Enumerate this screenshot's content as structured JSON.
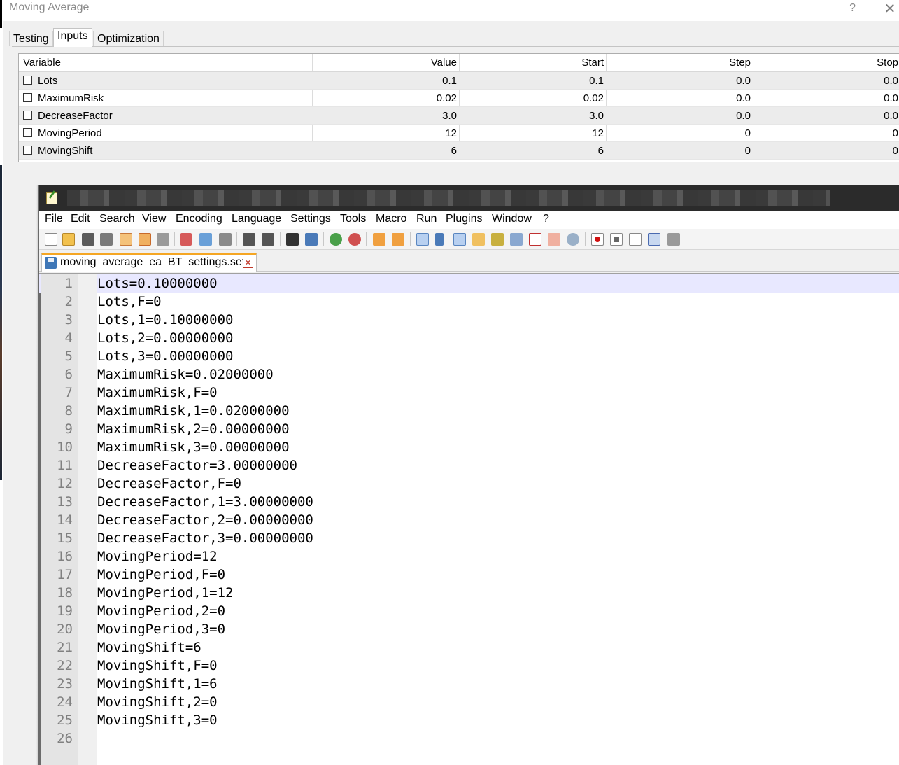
{
  "dialog": {
    "title": "Moving Average",
    "help_label": "?",
    "close_label": "✕",
    "tabs": [
      {
        "label": "Testing",
        "active": false
      },
      {
        "label": "Inputs",
        "active": true
      },
      {
        "label": "Optimization",
        "active": false
      }
    ],
    "grid": {
      "headers": [
        "Variable",
        "Value",
        "Start",
        "Step",
        "Stop"
      ],
      "rows": [
        {
          "variable": "Lots",
          "value": "0.1",
          "start": "0.1",
          "step": "0.0",
          "stop": "0.0",
          "checked": false
        },
        {
          "variable": "MaximumRisk",
          "value": "0.02",
          "start": "0.02",
          "step": "0.0",
          "stop": "0.0",
          "checked": false
        },
        {
          "variable": "DecreaseFactor",
          "value": "3.0",
          "start": "3.0",
          "step": "0.0",
          "stop": "0.0",
          "checked": false
        },
        {
          "variable": "MovingPeriod",
          "value": "12",
          "start": "12",
          "step": "0",
          "stop": "0",
          "checked": false
        },
        {
          "variable": "MovingShift",
          "value": "6",
          "start": "6",
          "step": "0",
          "stop": "0",
          "checked": false
        }
      ]
    }
  },
  "notepad": {
    "menu": [
      "File",
      "Edit",
      "Search",
      "View",
      "Encoding",
      "Language",
      "Settings",
      "Tools",
      "Macro",
      "Run",
      "Plugins",
      "Window",
      "?"
    ],
    "toolbar_icons": [
      "new-file-icon",
      "open-file-icon",
      "save-icon",
      "save-all-icon",
      "close-icon",
      "close-all-icon",
      "print-icon",
      "cut-icon",
      "copy-icon",
      "paste-icon",
      "undo-icon",
      "redo-icon",
      "find-icon",
      "replace-icon",
      "zoom-in-icon",
      "zoom-out-icon",
      "sync-vertical-icon",
      "sync-horizontal-icon",
      "word-wrap-icon",
      "show-all-chars-icon",
      "indent-guide-icon",
      "user-language-icon",
      "doc-map-icon",
      "doc-list-icon",
      "function-list-icon",
      "folder-workspace-icon",
      "monitoring-icon",
      "record-macro-icon",
      "stop-record-icon",
      "play-macro-icon",
      "run-macro-multiple-icon",
      "save-macro-icon"
    ],
    "active_tab": "moving_average_ea_BT_settings.set",
    "current_line": 1,
    "lines": [
      "Lots=0.10000000",
      "Lots,F=0",
      "Lots,1=0.10000000",
      "Lots,2=0.00000000",
      "Lots,3=0.00000000",
      "MaximumRisk=0.02000000",
      "MaximumRisk,F=0",
      "MaximumRisk,1=0.02000000",
      "MaximumRisk,2=0.00000000",
      "MaximumRisk,3=0.00000000",
      "DecreaseFactor=3.00000000",
      "DecreaseFactor,F=0",
      "DecreaseFactor,1=3.00000000",
      "DecreaseFactor,2=0.00000000",
      "DecreaseFactor,3=0.00000000",
      "MovingPeriod=12",
      "MovingPeriod,F=0",
      "MovingPeriod,1=12",
      "MovingPeriod,2=0",
      "MovingPeriod,3=0",
      "MovingShift=6",
      "MovingShift,F=0",
      "MovingShift,1=6",
      "MovingShift,2=0",
      "MovingShift,3=0",
      ""
    ]
  }
}
